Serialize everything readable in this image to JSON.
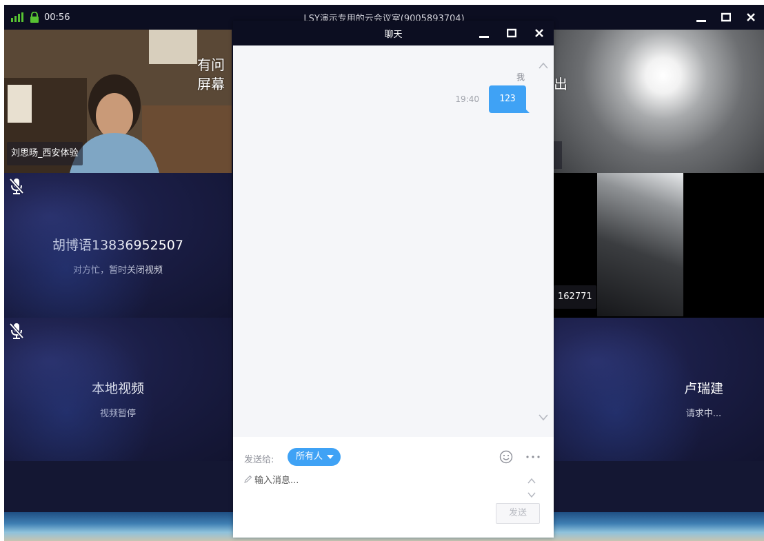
{
  "window": {
    "title": "LSY演示专用的云会议室(9005893704)",
    "time": "00:56"
  },
  "tiles": {
    "top_left": {
      "name_tag": "刘思旸_西安体验",
      "overlay_line1": "有问",
      "overlay_line2": "屏幕"
    },
    "top_right": {
      "overlay": "出"
    },
    "mid_left": {
      "name": "胡博语13836952507",
      "status": "对方忙，暂时关闭视频"
    },
    "mid_right": {
      "name_tag": "162771"
    },
    "bottom_left": {
      "name": "本地视频",
      "status": "视频暂停"
    },
    "bottom_right": {
      "name": "卢瑞建",
      "status": "请求中..."
    }
  },
  "chat": {
    "title": "聊天",
    "messages": [
      {
        "sender": "我",
        "time": "19:40",
        "text": "123"
      }
    ],
    "send_to_label": "发送给:",
    "recipient": "所有人",
    "input_placeholder": "输入消息...",
    "send_label": "发送"
  },
  "colors": {
    "accent": "#3fa2f5",
    "titlebar": "#0c0e21",
    "signal": "#57c232",
    "lock": "#57c232"
  },
  "icons": [
    "signal-icon",
    "lock-icon",
    "minimize-icon",
    "maximize-icon",
    "close-icon",
    "mic-off-icon",
    "emoji-icon",
    "more-icon",
    "pencil-icon",
    "chevron-up-icon",
    "chevron-down-icon"
  ]
}
